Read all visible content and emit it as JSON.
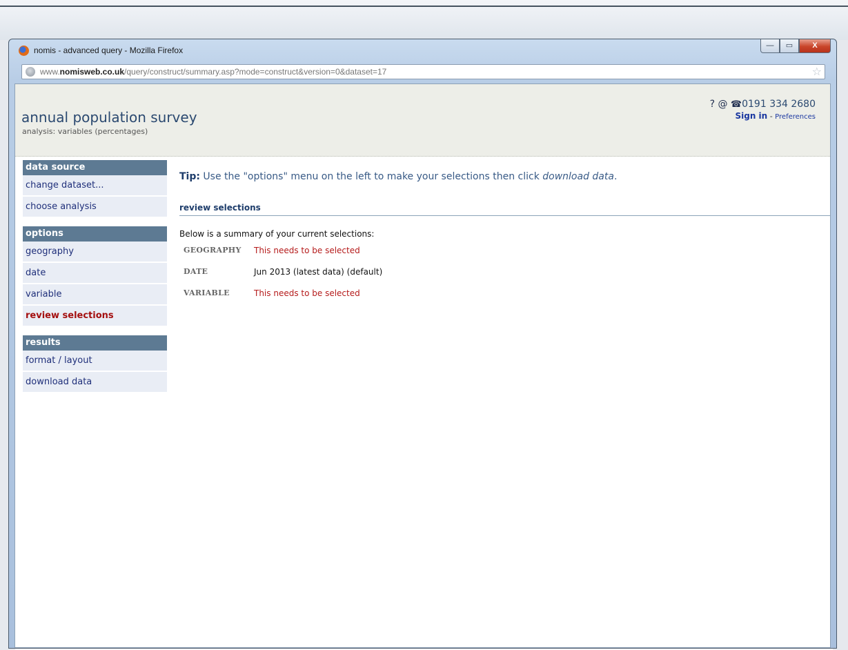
{
  "window": {
    "title": "nomis - advanced query - Mozilla Firefox",
    "buttons": {
      "minimize": "—",
      "maximize": "▭",
      "close": "X"
    }
  },
  "address": {
    "prefix": "www.",
    "domain": "nomisweb.co.uk",
    "path": "/query/construct/summary.asp?mode=construct&version=0&dataset=17"
  },
  "header": {
    "title": "annual population survey",
    "subtitle": "analysis: variables (percentages)",
    "help": "?",
    "at": "@",
    "phone": "0191 334 2680",
    "sign_in": "Sign in",
    "separator": " - ",
    "preferences": "Preferences"
  },
  "sidebar": {
    "sections": [
      {
        "heading": "data source",
        "items": [
          "change dataset...",
          "choose analysis"
        ]
      },
      {
        "heading": "options",
        "items": [
          "geography",
          "date",
          "variable",
          "review selections"
        ]
      },
      {
        "heading": "results",
        "items": [
          "format / layout",
          "download data"
        ]
      }
    ],
    "active_item": "review selections"
  },
  "main": {
    "tip_label": "Tip:",
    "tip_text": " Use the \"options\" menu on the left to make your selections then click ",
    "tip_link": "download data",
    "tip_end": ".",
    "section_title": "review selections",
    "intro": "Below is a summary of your current selections:",
    "selections": [
      {
        "key": "GEOGRAPHY",
        "value": "This needs to be selected",
        "warning": true
      },
      {
        "key": "DATE",
        "value": "Jun 2013 (latest data) (default)",
        "warning": false
      },
      {
        "key": "VARIABLE",
        "value": "This needs to be selected",
        "warning": true
      }
    ]
  },
  "colors": {
    "accent": "#2b4970",
    "sidebar_heading": "#5d7a93",
    "sidebar_item_bg": "#e9edf5",
    "warning": "#b51b1b",
    "active": "#a40f0f"
  }
}
